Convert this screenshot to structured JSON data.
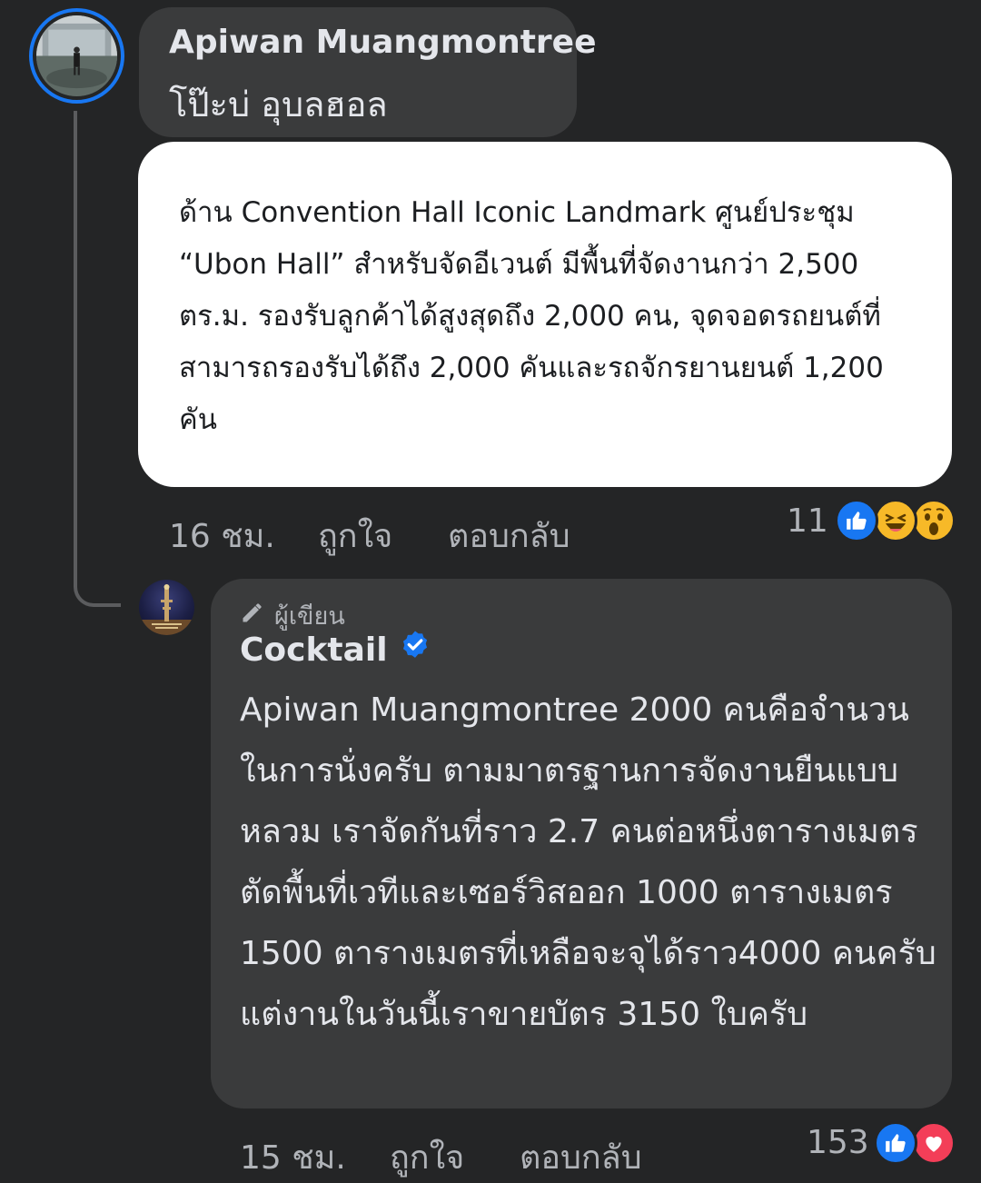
{
  "comment1": {
    "author": "Apiwan Muangmontree",
    "text": "โป๊ะบ่ อุบลฮอล",
    "quote": "ด้าน Convention Hall Iconic Landmark ศูนย์ประชุม “Ubon Hall” สำหรับจัดอีเวนต์ มีพื้นที่จัดงานกว่า 2,500 ตร.ม. รองรับลูกค้าได้สูงสุดถึง 2,000 คน, จุดจอดรถยนต์ที่สามารถรองรับได้ถึง 2,000 คันและรถจักรยานยนต์ 1,200 คัน",
    "time": "16 ชม.",
    "like_label": "ถูกใจ",
    "reply_label": "ตอบกลับ",
    "reaction_count": "11",
    "reactions": [
      "like-icon",
      "haha-icon",
      "wow-icon"
    ]
  },
  "comment2": {
    "badge": "ผู้เขียน",
    "author": "Cocktail",
    "verified": true,
    "text": "Apiwan Muangmontree 2000 คนคือจำนวนในการนั่งครับ ตามมาตรฐานการจัดงานยืนแบบหลวม เราจัดกันที่ราว 2.7 คนต่อหนึ่งตารางเมตร ตัดพื้นที่เวทีและเซอร์วิสออก 1000 ตารางเมตร 1500 ตารางเมตรที่เหลือจะจุได้ราว4000 คนครับ แต่งานในวันนี้เราขายบัตร 3150 ใบครับ",
    "time": "15 ชม.",
    "like_label": "ถูกใจ",
    "reply_label": "ตอบกลับ",
    "reaction_count": "153",
    "reactions": [
      "like-icon",
      "love-icon"
    ]
  },
  "colors": {
    "background": "#242526",
    "bubble": "#3a3b3c",
    "text_primary": "#e4e6eb",
    "text_secondary": "#b0b3b8",
    "like_blue": "#1877f2",
    "love_red": "#f33e58",
    "haha_yellow": "#f7b928"
  }
}
